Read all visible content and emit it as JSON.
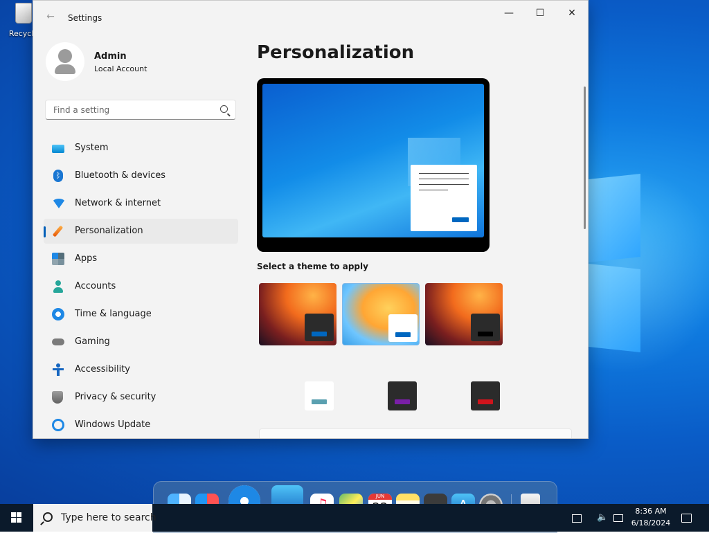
{
  "desktop": {
    "recycle_bin_label": "Recycle"
  },
  "window": {
    "title": "Settings",
    "controls": {
      "minimize": "—",
      "maximize": "☐",
      "close": "✕"
    }
  },
  "profile": {
    "name": "Admin",
    "account_type": "Local Account"
  },
  "search": {
    "placeholder": "Find a setting"
  },
  "nav": {
    "items": [
      {
        "label": "System",
        "icon": "system-icon"
      },
      {
        "label": "Bluetooth & devices",
        "icon": "bluetooth-icon"
      },
      {
        "label": "Network & internet",
        "icon": "wifi-icon"
      },
      {
        "label": "Personalization",
        "icon": "brush-icon",
        "active": true
      },
      {
        "label": "Apps",
        "icon": "apps-icon"
      },
      {
        "label": "Accounts",
        "icon": "person-icon"
      },
      {
        "label": "Time & language",
        "icon": "globe-clock-icon"
      },
      {
        "label": "Gaming",
        "icon": "gamepad-icon"
      },
      {
        "label": "Accessibility",
        "icon": "accessibility-icon"
      },
      {
        "label": "Privacy & security",
        "icon": "shield-icon"
      },
      {
        "label": "Windows Update",
        "icon": "update-icon"
      }
    ]
  },
  "content": {
    "title": "Personalization",
    "theme_caption": "Select a theme to apply"
  },
  "colors": {
    "accent": "#0067c0",
    "theme_swatches": [
      "#5aa0b0",
      "#7a1fa8",
      "#d0141c"
    ]
  },
  "dock": {
    "apps": [
      "finder-icon",
      "launchpad-icon",
      "safari-icon",
      "mail-icon",
      "music-icon",
      "maps-icon",
      "calendar-icon",
      "notes-icon",
      "calculator-icon",
      "app-store-icon",
      "system-preferences-icon",
      "trash-icon"
    ],
    "calendar_month": "JUN",
    "calendar_day": "22"
  },
  "taskbar": {
    "search_placeholder": "Type here to search",
    "time": "8:36 AM",
    "date": "6/18/2024"
  }
}
